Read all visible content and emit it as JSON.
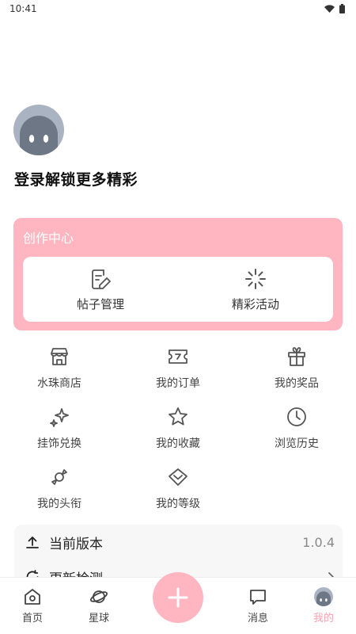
{
  "status_bar": {
    "time": "10:41"
  },
  "profile": {
    "login_prompt": "登录解锁更多精彩"
  },
  "creator_center": {
    "title": "创作中心",
    "items": [
      {
        "label": "帖子管理",
        "icon": "edit-document-icon"
      },
      {
        "label": "精彩活动",
        "icon": "loading-spinner-icon"
      }
    ]
  },
  "menu_grid": [
    {
      "label": "水珠商店",
      "icon": "shop-icon"
    },
    {
      "label": "我的订单",
      "icon": "ticket-icon"
    },
    {
      "label": "我的奖品",
      "icon": "gift-icon"
    },
    {
      "label": "挂饰兑换",
      "icon": "sparkle-icon"
    },
    {
      "label": "我的收藏",
      "icon": "star-icon"
    },
    {
      "label": "浏览历史",
      "icon": "clock-icon"
    },
    {
      "label": "我的头衔",
      "icon": "candy-icon"
    },
    {
      "label": "我的等级",
      "icon": "level-icon"
    }
  ],
  "info": {
    "version_label": "当前版本",
    "version_value": "1.0.4",
    "update_label": "更新检测"
  },
  "tab_bar": {
    "items": [
      {
        "label": "首页",
        "icon": "home-icon"
      },
      {
        "label": "星球",
        "icon": "planet-icon"
      },
      {
        "label": "消息",
        "icon": "message-icon"
      },
      {
        "label": "我的",
        "icon": "avatar-icon",
        "active": true
      }
    ]
  },
  "colors": {
    "accent": "#ffb6c1",
    "accent_text": "#ff9fb0"
  }
}
